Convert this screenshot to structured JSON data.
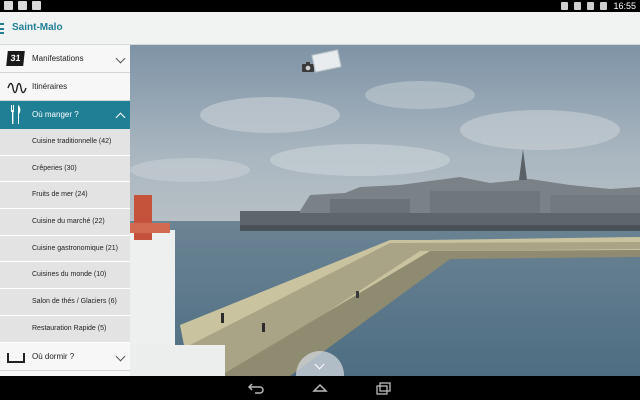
{
  "status_bar": {
    "time": "16:55"
  },
  "app_bar": {
    "title": "Saint-Malo",
    "menu_icon": "hamburger-icon"
  },
  "sidebar": {
    "manifestations": {
      "icon": "calendar-31-icon",
      "icon_text": "31",
      "label": "Manifestations"
    },
    "itineraires": {
      "icon": "route-icon",
      "label": "Itinéraires"
    },
    "ou_manger": {
      "icon": "cutlery-icon",
      "label": "Où manger ?"
    },
    "sub_items": [
      "Cuisine traditionnelle (42)",
      "Crêperies (30)",
      "Fruits de mer (24)",
      "Cuisine du marché (22)",
      "Cuisine gastronomique (21)",
      "Cuisines du monde (10)",
      "Salon de thés / Glaciers (6)",
      "Restauration Rapide (5)"
    ],
    "ou_dormir": {
      "icon": "bed-icon",
      "label": "Où dormir ?"
    }
  },
  "photo": {
    "alt": "",
    "icons": [
      "camera-icon",
      "postcard-icon"
    ]
  },
  "colors": {
    "accent": "#1f7f95",
    "appbar_bg": "#f1f3f3",
    "submenu_bg": "#e3e3e3"
  }
}
